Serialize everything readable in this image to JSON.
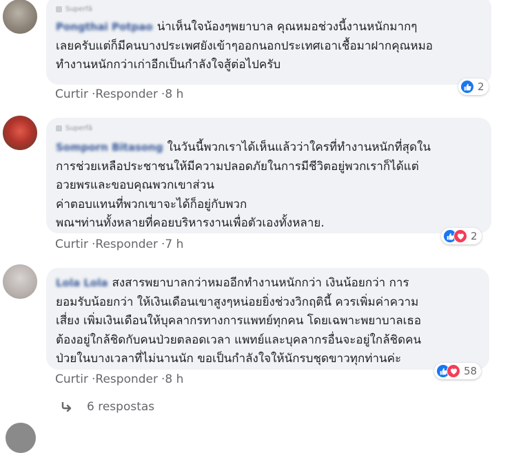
{
  "comments": [
    {
      "author": "Pongthai Potpao",
      "badge": "Superfã",
      "lines": [
        "น่าเห็นใจน้องๆพยาบาล คุณหมอช่วงนี้งานหนักมากๆ",
        "เลยครับแต่ก็มีคนบางประเพศยังเข้าๆออกนอกประเทศเอาเชื้อมาฝากคุณหมอ",
        "ทำงานหนักกว่าเก่าอีกเป็นกำลังใจสู้ต่อไปครับ"
      ],
      "reactions": [
        "like"
      ],
      "reaction_count": "2",
      "actions": {
        "like": "Curtir",
        "reply": "Responder",
        "time": "8 h"
      }
    },
    {
      "author": "Somporn Bitasong",
      "badge": "Superfã",
      "lines": [
        "ในวันนี้พวกเราได้เห็นแล้วว่าใครที่ทำงานหนักที่สุดใน",
        "การช่วยเหลือประชาชนให้มีความปลอดภัยในการมีชีวิตอยู่พวกเราก็ได้แต่",
        "อวยพรและขอบคุณพวกเขาส่วน",
        "ค่าตอบแทนที่พวกเขาจะได้ก็อยู่กับพวก",
        "พณฯท่านทั้งหลายที่คอยบริหารงานเพื่อตัวเองทั้งหลาย."
      ],
      "reactions": [
        "like",
        "love"
      ],
      "reaction_count": "2",
      "actions": {
        "like": "Curtir",
        "reply": "Responder",
        "time": "7 h"
      }
    },
    {
      "author": "Lola Lola",
      "badge": "",
      "lines": [
        "สงสารพยาบาลกว่าหมออีกทำงานหนักกว่า เงินน้อยกว่า การ",
        "ยอมรับน้อยกว่า ให้เงินเดือนเขาสูงๆหน่อยยิ่งช่วงวิกฤตินี้ ควรเพิ่มค่าความ",
        "เสี่ยง เพิ่มเงินเดือนให้บุคลากรทางการแพทย์ทุกคน โดยเฉพาะพยาบาลเธอ",
        "ต้องอยู่ใกล้ชิดกับคนป่วยตลอดเวลา แพทย์และบุคลากรอื่นจะอยู่ใกล้ชิดคน",
        "ป่วยในบางเวลาที่ไม่นานนัก ขอเป็นกำลังใจให้นักรบชุดขาวทุกท่านค่ะ"
      ],
      "reactions": [
        "like",
        "love"
      ],
      "reaction_count": "58",
      "actions": {
        "like": "Curtir",
        "reply": "Responder",
        "time": "8 h"
      }
    }
  ],
  "replies_label": "6 respostas",
  "colors": {
    "like": "#1877f2",
    "love": "#f33e58",
    "bubble": "#f0f2f5",
    "meta": "#65676b",
    "author": "#385898"
  },
  "icons": {
    "reply": "reply-arrow-icon",
    "like": "thumbs-up-icon",
    "love": "heart-icon"
  }
}
